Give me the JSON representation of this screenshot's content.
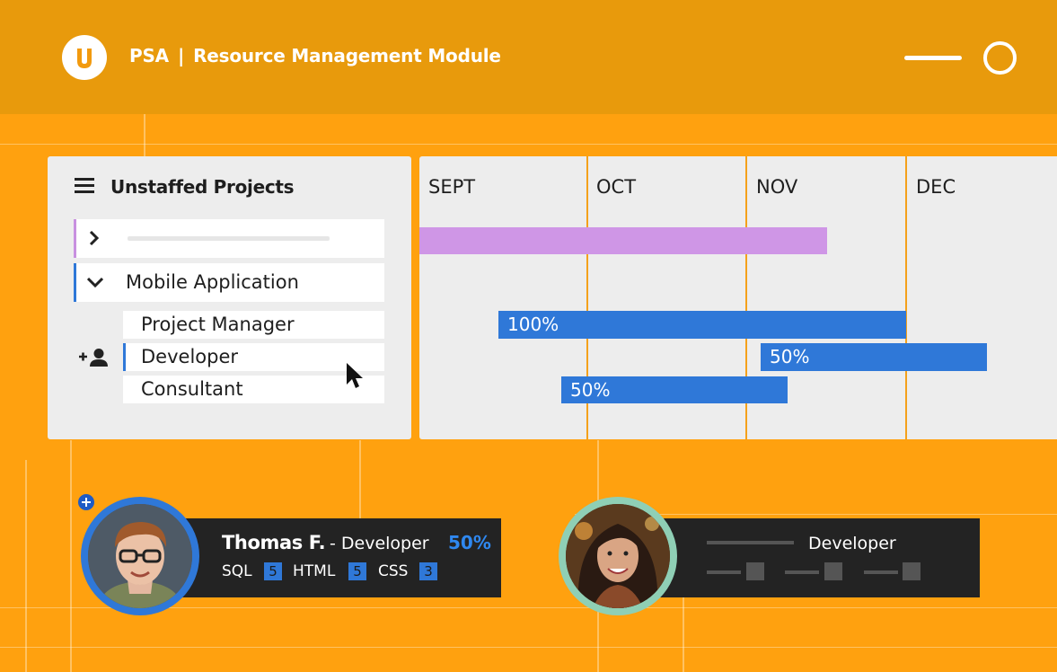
{
  "header": {
    "product": "PSA",
    "separator": "|",
    "module": "Resource Management Module",
    "logo_icon": "u-logo-icon",
    "window_controls": [
      "minimize-icon",
      "maximize-icon"
    ]
  },
  "panel": {
    "title": "Unstaffed Projects",
    "menu_icon": "hamburger-icon",
    "projects": [
      {
        "label": "",
        "expanded": false,
        "accent": "#C890E0"
      },
      {
        "label": "Mobile Application",
        "expanded": true,
        "accent": "#2F78D8"
      }
    ],
    "roles": [
      {
        "label": "Project Manager",
        "active": false
      },
      {
        "label": "Developer",
        "active": true
      },
      {
        "label": "Consultant",
        "active": false
      }
    ]
  },
  "gantt": {
    "months": [
      "SEPT",
      "OCT",
      "NOV",
      "DEC"
    ],
    "bars": [
      {
        "row": "collapsed-project",
        "label": "",
        "color": "#CF96E6"
      },
      {
        "row": "project-manager",
        "label": "100%",
        "color": "#2F78D8"
      },
      {
        "row": "developer",
        "label": "50%",
        "color": "#2F78D8"
      },
      {
        "row": "consultant",
        "label": "50%",
        "color": "#2F78D8"
      }
    ]
  },
  "candidates": [
    {
      "name": "Thomas F.",
      "role": " - Developer",
      "allocation": "50%",
      "ring_color": "#2F78D8",
      "skills": [
        {
          "name": "SQL",
          "level": "5"
        },
        {
          "name": "HTML",
          "level": "5"
        },
        {
          "name": "CSS",
          "level": "3"
        }
      ]
    },
    {
      "name": "",
      "role": "Developer",
      "ring_color": "#8FCFB5",
      "skills": []
    }
  ],
  "colors": {
    "background": "#FFA10F",
    "header": "#E89A0C",
    "accent_blue": "#2F78D8",
    "card": "#232323"
  }
}
